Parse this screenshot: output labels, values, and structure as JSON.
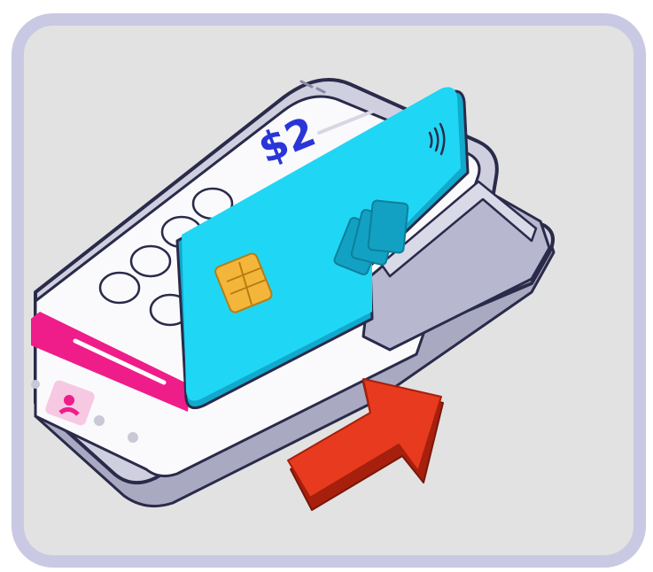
{
  "illustration": {
    "screen": {
      "amount_text": "$2"
    },
    "colors": {
      "panel_fill": "#e2e2e2",
      "panel_border": "#c9c9e4",
      "device_body": "#cfcfe0",
      "device_outline": "#2a2a4a",
      "screen_bg": "#fafafc",
      "amount_color": "#2a35d8",
      "accent_magenta": "#ee1d8a",
      "card_cyan": "#20d6f5",
      "card_shadow": "#11a9cc",
      "chip_gold": "#f4b63a",
      "arrow_red": "#e83a1e",
      "arrow_dark": "#a6200d"
    },
    "icons": [
      "contactless-icon",
      "cards-stack-icon",
      "chip-icon",
      "arrow-icon",
      "person-icon"
    ]
  }
}
